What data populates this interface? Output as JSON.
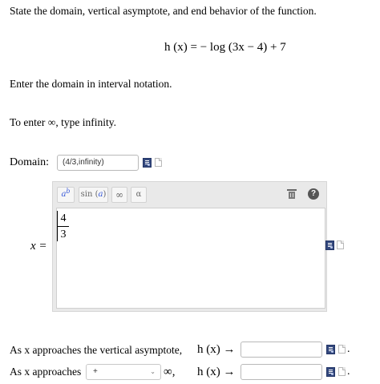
{
  "question": {
    "prompt": "State the domain, vertical asymptote, and end behavior of the function.",
    "function_display": "h (x) = − log (3x − 4) + 7",
    "domain_instruction": "Enter the domain in interval notation.",
    "infinity_hint": "To enter ∞, type infinity."
  },
  "domain_row": {
    "label": "Domain:",
    "value": "(4/3,infinity)"
  },
  "math_editor": {
    "label": "x =",
    "toolbar": {
      "superscript_a": "a",
      "superscript_b": "b",
      "sin_prefix": "sin (",
      "sin_var": "a",
      "sin_suffix": ")",
      "infinity": "∞",
      "alpha": "α",
      "help": "?"
    },
    "fraction": {
      "numerator": "4",
      "denominator": "3"
    }
  },
  "end_behavior": {
    "vertical_label": "As x approaches the vertical asymptote,",
    "vertical_function": "h (x) →",
    "approach_label": "As x approaches",
    "select_value": "+",
    "infinity_comma": "∞,",
    "approach_function": "h (x) →",
    "period": "."
  }
}
